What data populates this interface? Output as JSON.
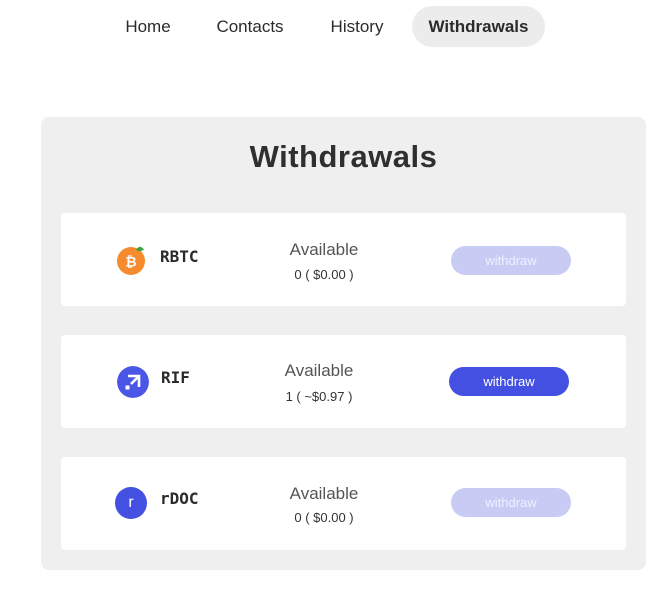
{
  "nav": {
    "items": [
      {
        "label": "Home",
        "active": false
      },
      {
        "label": "Contacts",
        "active": false
      },
      {
        "label": "History",
        "active": false
      },
      {
        "label": "Withdrawals",
        "active": true
      }
    ]
  },
  "panel": {
    "title": "Withdrawals",
    "tokens": [
      {
        "symbol": "RBTC",
        "available_label": "Available",
        "available_value": "0 ( $0.00 )",
        "button_label": "withdraw",
        "button_enabled": false,
        "icon": "bitcoin-orange-icon"
      },
      {
        "symbol": "RIF",
        "available_label": "Available",
        "available_value": "1 ( ~$0.97 )",
        "button_label": "withdraw",
        "button_enabled": true,
        "icon": "rif-arrow-icon"
      },
      {
        "symbol": "rDOC",
        "available_label": "Available",
        "available_value": "0 ( $0.00 )",
        "button_label": "withdraw",
        "button_enabled": false,
        "icon": "rdoc-letter-icon",
        "icon_letter": "r"
      }
    ]
  },
  "colors": {
    "accent": "#4350e2",
    "accent_disabled": "#c8ccf5",
    "rbtc_orange": "#f58a2f",
    "rif_blue": "#4a57e6",
    "panel_bg": "#efefef"
  }
}
